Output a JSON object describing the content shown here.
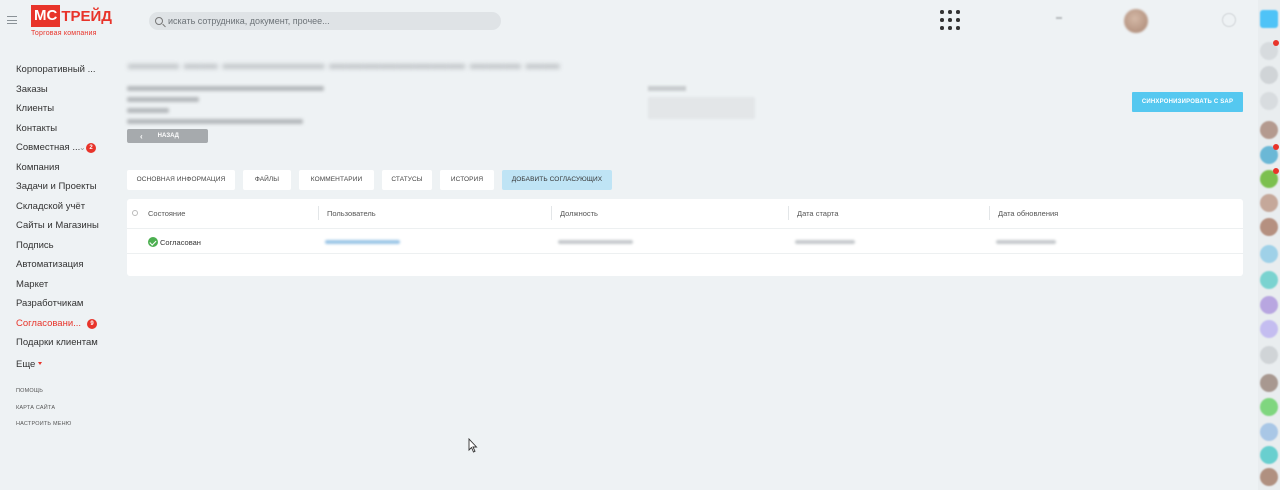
{
  "header": {
    "logo_mc": "МС",
    "logo_rest": "ТРЕЙД",
    "logo_subtitle": "Торговая компания",
    "search_placeholder": "искать сотрудника, документ, прочее..."
  },
  "sidebar": {
    "items": [
      {
        "label": "Корпоративный ...",
        "active": false
      },
      {
        "label": "Заказы",
        "active": false
      },
      {
        "label": "Клиенты",
        "active": false
      },
      {
        "label": "Контакты",
        "active": false
      },
      {
        "label": "Совместная ...",
        "active": false,
        "badge": "2"
      },
      {
        "label": "Компания",
        "active": false
      },
      {
        "label": "Задачи и Проекты",
        "active": false
      },
      {
        "label": "Складской учёт",
        "active": false
      },
      {
        "label": "Сайты и Магазины",
        "active": false
      },
      {
        "label": "Подпись",
        "active": false
      },
      {
        "label": "Автоматизация",
        "active": false
      },
      {
        "label": "Маркет",
        "active": false
      },
      {
        "label": "Разработчикам",
        "active": false
      },
      {
        "label": "Согласовани...",
        "active": true,
        "badge": "9"
      },
      {
        "label": "Подарки клиентам",
        "active": false
      },
      {
        "label": "Еще",
        "active": false
      }
    ],
    "small_links": [
      "ПОМОЩЬ",
      "КАРТА САЙТА",
      "НАСТРОИТЬ МЕНЮ"
    ]
  },
  "page": {
    "back_label": "НАЗАД",
    "sync_label": "СИНХРОНИЗИРОВАТЬ С SAP"
  },
  "tabs": [
    {
      "label": "ОСНОВНАЯ ИНФОРМАЦИЯ"
    },
    {
      "label": "ФАЙЛЫ"
    },
    {
      "label": "КОММЕНТАРИИ"
    },
    {
      "label": "СТАТУСЫ"
    },
    {
      "label": "ИСТОРИЯ"
    },
    {
      "label": "ДОБАВИТЬ СОГЛАСУЮЩИХ"
    }
  ],
  "table": {
    "columns": [
      "Состояние",
      "Пользователь",
      "Должность",
      "Дата старта",
      "Дата обновления"
    ],
    "rows": [
      {
        "status": "Согласован"
      }
    ]
  },
  "colors": {
    "brand": "#e8342a",
    "sync_button": "#55c8f0",
    "approved": "#4caf50"
  }
}
